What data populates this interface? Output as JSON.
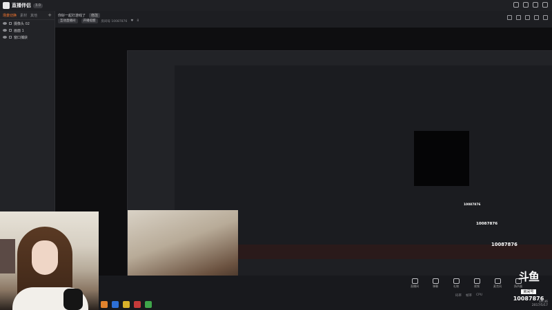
{
  "app": {
    "name": "直播伴侣",
    "version": "3.0"
  },
  "window_icons": [
    "user-icon",
    "minimize-icon",
    "maximize-icon",
    "close-icon"
  ],
  "sidebar": {
    "tabs": [
      {
        "label": "场景切换",
        "active": true
      },
      {
        "label": "素材",
        "active": false
      },
      {
        "label": "其他",
        "active": false
      }
    ],
    "add_label": "+",
    "items": [
      {
        "label": "摄像头 02"
      },
      {
        "label": "画面 1"
      },
      {
        "label": "窗口捕获"
      }
    ]
  },
  "header": {
    "room_title": "你好一起打游戏了",
    "modify_label": "修改",
    "chips": [
      "互动直播间",
      "开播提醒"
    ],
    "room_meta": "房间号 10087876",
    "like_count": "8"
  },
  "bottom_bar": {
    "actions": [
      {
        "label": "直播间",
        "icon": "monitor-icon"
      },
      {
        "label": "弹幕",
        "icon": "shield-icon"
      },
      {
        "label": "礼物",
        "icon": "gift-icon"
      },
      {
        "label": "视频",
        "icon": "video-icon"
      },
      {
        "label": "麦克风",
        "icon": "mic-icon"
      },
      {
        "label": "扬声器",
        "icon": "speaker-icon"
      }
    ],
    "status_items": [
      "码率",
      "帧率",
      "CPU"
    ],
    "clock_time": "19:36",
    "clock_date": "2017/5/17"
  },
  "watermark": {
    "logo": "斗鱼",
    "label": "房间号",
    "room_number": "10087876"
  },
  "colors": {
    "accent": "#ff7a2f",
    "bg": "#1b1c20",
    "panel": "#222327"
  }
}
